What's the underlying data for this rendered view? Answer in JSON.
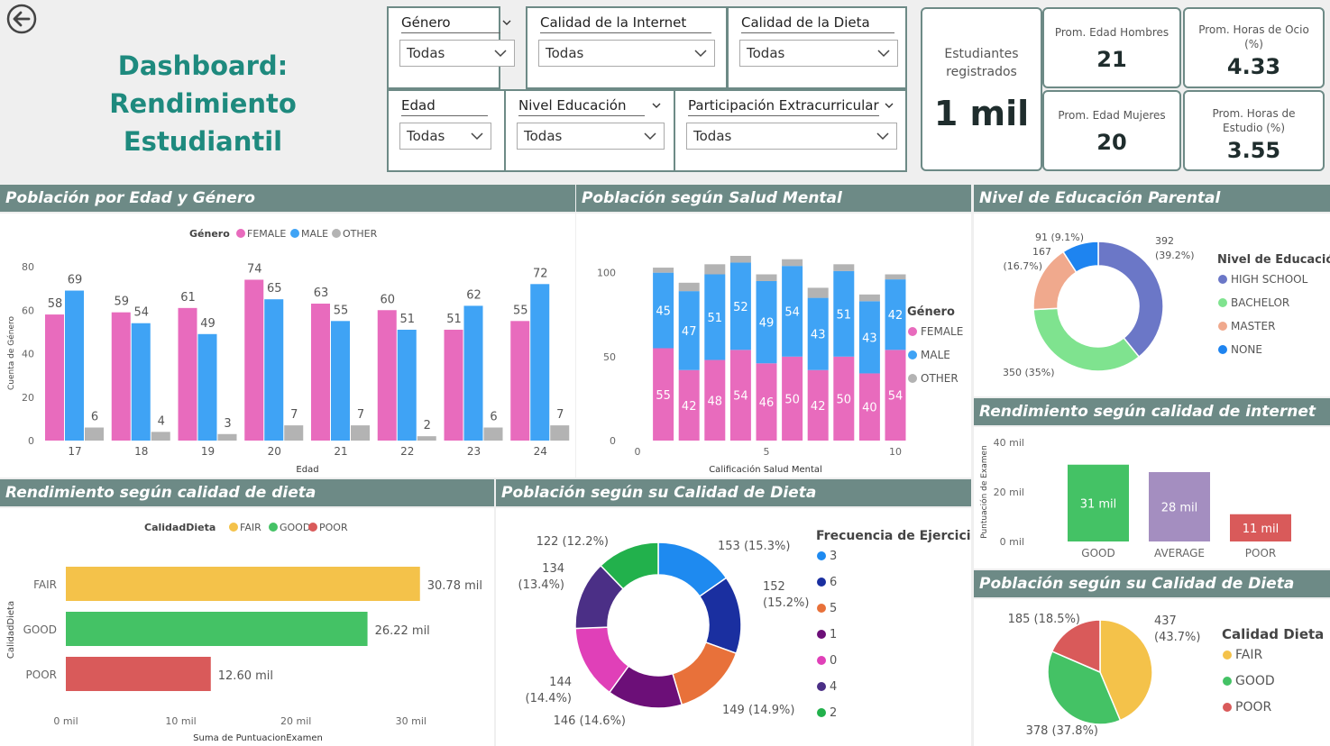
{
  "title": "Dashboard: Rendimiento Estudiantil",
  "slicers": [
    {
      "label": "Género",
      "value": "Todas"
    },
    {
      "label": "Calidad de la Internet",
      "value": "Todas"
    },
    {
      "label": "Calidad de la Dieta",
      "value": "Todas"
    },
    {
      "label": "Edad",
      "value": "Todas"
    },
    {
      "label": "Nivel Educación",
      "value": "Todas"
    },
    {
      "label": "Participación Extracurricular",
      "value": "Todas"
    }
  ],
  "cards": {
    "students": {
      "label": "Estudiantes registrados",
      "value": "1 mil"
    },
    "age_men": {
      "label": "Prom. Edad Hombres",
      "value": "21"
    },
    "leisure": {
      "label": "Prom. Horas de Ocio (%)",
      "value": "4.33"
    },
    "age_women": {
      "label": "Prom. Edad Mujeres",
      "value": "20"
    },
    "study": {
      "label": "Prom. Horas de Estudio (%)",
      "value": "3.55"
    }
  },
  "sections": {
    "age_gender": "Población por Edad y Género",
    "mental": "Población según Salud Mental",
    "parent_edu": "Nivel de Educación Parental",
    "internet": "Rendimiento según calidad de internet",
    "diet_perf": "Rendimiento según calidad de dieta",
    "diet_pop": "Población según su Calidad de Dieta",
    "diet_pop2": "Población según su Calidad de Dieta"
  },
  "colors": {
    "female": "#e86bbd",
    "male": "#3fa3f5",
    "other": "#b3b3b3",
    "fair": "#f4c24a",
    "good": "#44c265",
    "poor": "#d95a5a",
    "header": "#6d8a86",
    "title": "#1e8a7e"
  },
  "chart_data": [
    {
      "id": "age_gender",
      "type": "bar",
      "legend_title": "Género",
      "categories": [
        "17",
        "18",
        "19",
        "20",
        "21",
        "22",
        "23",
        "24"
      ],
      "series": [
        {
          "name": "FEMALE",
          "values": [
            58,
            59,
            61,
            74,
            63,
            60,
            51,
            55
          ]
        },
        {
          "name": "MALE",
          "values": [
            69,
            54,
            49,
            65,
            55,
            51,
            62,
            72
          ]
        },
        {
          "name": "OTHER",
          "values": [
            6,
            4,
            3,
            7,
            7,
            2,
            6,
            7
          ]
        }
      ],
      "xlabel": "Edad",
      "ylabel": "Cuenta de Género",
      "ylim": [
        0,
        80
      ],
      "yticks": [
        "0",
        "20",
        "40",
        "60",
        "80"
      ]
    },
    {
      "id": "mental",
      "type": "bar",
      "stacked": true,
      "legend_title": "Género",
      "x": [
        1,
        2,
        3,
        4,
        5,
        6,
        7,
        8,
        9,
        10
      ],
      "series": [
        {
          "name": "FEMALE",
          "values": [
            55,
            42,
            48,
            54,
            46,
            50,
            42,
            50,
            40,
            54
          ]
        },
        {
          "name": "MALE",
          "values": [
            45,
            47,
            51,
            52,
            49,
            54,
            43,
            51,
            43,
            42
          ]
        },
        {
          "name": "OTHER",
          "values": [
            3,
            5,
            6,
            4,
            4,
            4,
            6,
            4,
            4,
            3
          ]
        }
      ],
      "xlabel": "Calificación Salud Mental",
      "ylim": [
        0,
        110
      ],
      "yticks": [
        "0",
        "50",
        "100"
      ],
      "xticks": [
        "0",
        "5",
        "10"
      ]
    },
    {
      "id": "parent_edu",
      "type": "pie",
      "donut": true,
      "legend_title": "Nivel de Educació...",
      "slices": [
        {
          "name": "HIGH SCHOOL",
          "value": 392,
          "label": "392 (39.2%)"
        },
        {
          "name": "BACHELOR",
          "value": 350,
          "label": "350 (35%)"
        },
        {
          "name": "MASTER",
          "value": 167,
          "label": "167 (16.7%)"
        },
        {
          "name": "NONE",
          "value": 91,
          "label": "91 (9.1%)"
        }
      ]
    },
    {
      "id": "internet",
      "type": "bar",
      "categories": [
        "GOOD",
        "AVERAGE",
        "POOR"
      ],
      "values": [
        31,
        28,
        11
      ],
      "data_labels": [
        "31 mil",
        "28 mil",
        "11 mil"
      ],
      "ylabel": "Puntuación de Examen",
      "ylim": [
        0,
        40
      ],
      "yticks": [
        "0 mil",
        "20 mil",
        "40 mil"
      ]
    },
    {
      "id": "diet_perf",
      "type": "bar",
      "orientation": "horizontal",
      "legend_title": "CalidadDieta",
      "categories": [
        "FAIR",
        "GOOD",
        "POOR"
      ],
      "values": [
        30.78,
        26.22,
        12.6
      ],
      "data_labels": [
        "30.78 mil",
        "26.22 mil",
        "12.60 mil"
      ],
      "xlabel": "Suma de PuntuacionExamen",
      "ylabel": "CalidadDieta",
      "xlim": [
        0,
        34
      ],
      "xticks": [
        "0 mil",
        "10 mil",
        "20 mil",
        "30 mil"
      ]
    },
    {
      "id": "exercise",
      "type": "pie",
      "donut": true,
      "legend_title": "Frecuencia de Ejercicio",
      "slices": [
        {
          "name": "3",
          "value": 153,
          "label": "153 (15.3%)"
        },
        {
          "name": "6",
          "value": 152,
          "label": "152 (15.2%)"
        },
        {
          "name": "5",
          "value": 149,
          "label": "149 (14.9%)"
        },
        {
          "name": "1",
          "value": 146,
          "label": "146 (14.6%)"
        },
        {
          "name": "0",
          "value": 144,
          "label": "144 (14.4%)"
        },
        {
          "name": "4",
          "value": 134,
          "label": "134 (13.4%)"
        },
        {
          "name": "2",
          "value": 122,
          "label": "122 (12.2%)"
        }
      ]
    },
    {
      "id": "diet_pie",
      "type": "pie",
      "legend_title": "Calidad Dieta",
      "slices": [
        {
          "name": "FAIR",
          "value": 437,
          "label": "437 (43.7%)"
        },
        {
          "name": "GOOD",
          "value": 378,
          "label": "378 (37.8%)"
        },
        {
          "name": "POOR",
          "value": 185,
          "label": "185 (18.5%)"
        }
      ]
    }
  ]
}
